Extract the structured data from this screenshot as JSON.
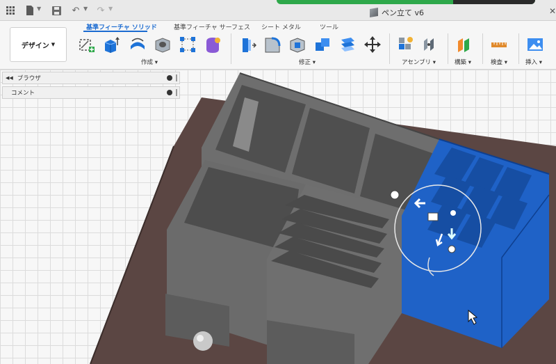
{
  "appbar": {
    "document_title": "ペン立て v6"
  },
  "ribbon": {
    "workspace_label": "デザイン",
    "tabs": [
      {
        "label": "基準フィーチャ ソリッド",
        "active": true
      },
      {
        "label": "基準フィーチャ サーフェス",
        "active": false
      },
      {
        "label": "シート メタル",
        "active": false
      },
      {
        "label": "ツール",
        "active": false
      }
    ],
    "groups": {
      "create": "作成 ▾",
      "modify": "修正 ▾",
      "assemble": "アセンブリ ▾",
      "construct": "構築 ▾",
      "inspect": "検査 ▾",
      "insert": "挿入 ▾"
    }
  },
  "panels": {
    "browser": "ブラウザ",
    "comments": "コメント"
  },
  "colors": {
    "accent": "#1b6bd1",
    "selected_body": "#1f62c7",
    "model_gray": "#6b6b6b",
    "base_plate": "#5b4643",
    "green_bar": "#2ea84a"
  }
}
